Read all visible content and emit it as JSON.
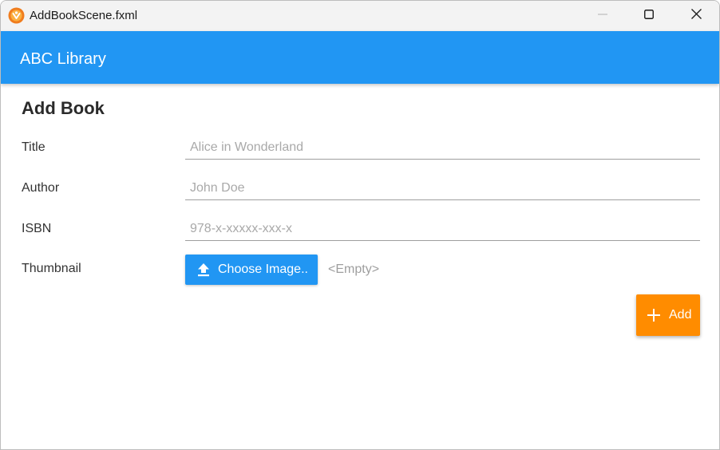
{
  "window": {
    "title": "AddBookScene.fxml",
    "app_icon": "fx-app-icon",
    "controls": {
      "minimize": "minimize-icon",
      "maximize": "maximize-icon",
      "close": "close-icon"
    }
  },
  "appbar": {
    "title": "ABC Library",
    "color": "#2196f3"
  },
  "form": {
    "heading": "Add Book",
    "fields": {
      "title": {
        "label": "Title",
        "value": "",
        "placeholder": "Alice in Wonderland"
      },
      "author": {
        "label": "Author",
        "value": "",
        "placeholder": "John Doe"
      },
      "isbn": {
        "label": "ISBN",
        "value": "",
        "placeholder": "978-x-xxxxx-xxx-x"
      },
      "thumbnail": {
        "label": "Thumbnail",
        "button_label": "Choose Image..",
        "button_icon": "upload-icon",
        "status": "<Empty>"
      }
    },
    "add_button": {
      "label": "Add",
      "icon": "plus-icon",
      "color": "#ff8c00"
    }
  }
}
